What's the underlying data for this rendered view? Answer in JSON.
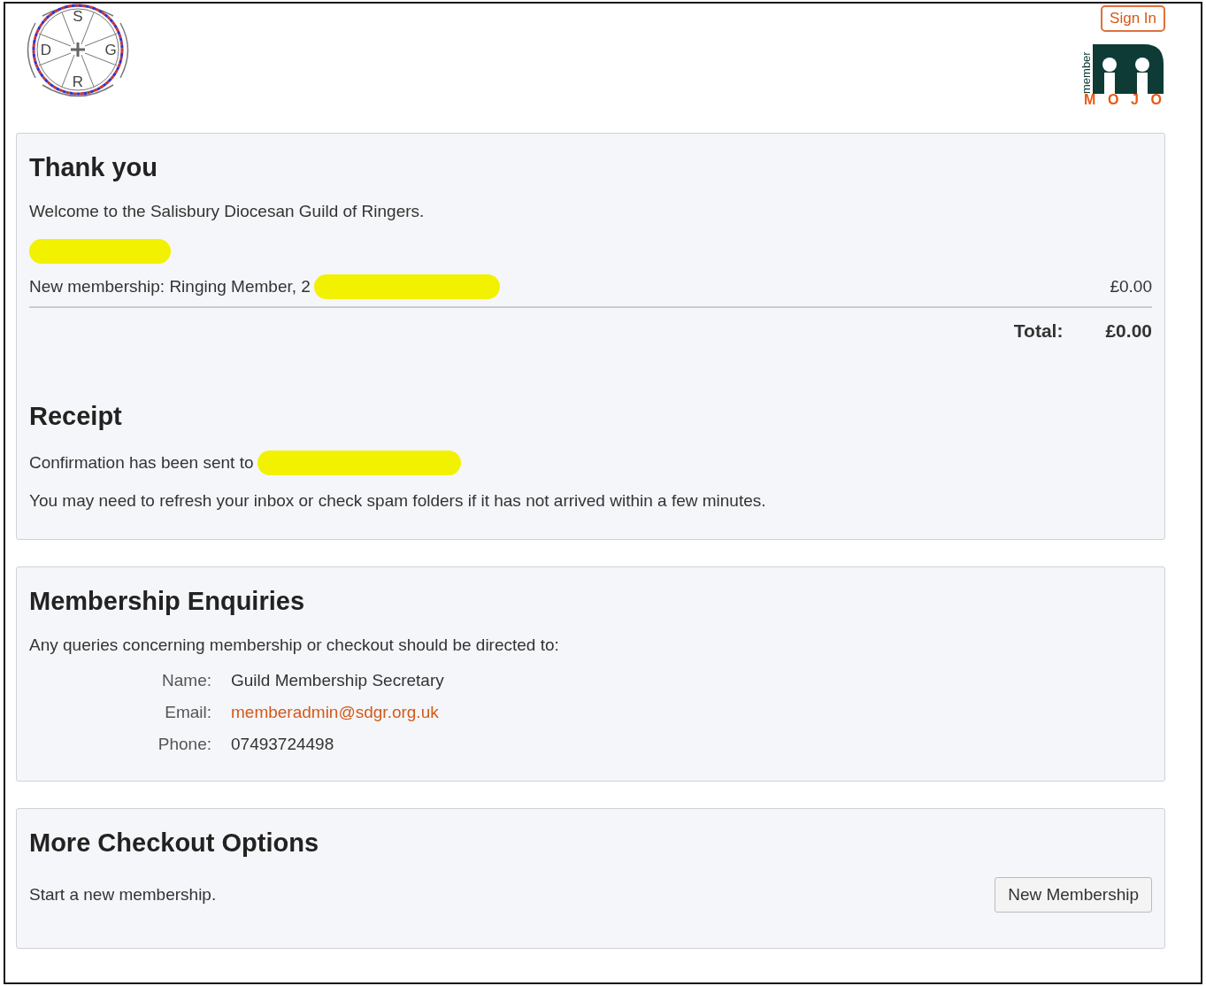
{
  "header": {
    "guild_logo_letters": [
      "S",
      "D",
      "G",
      "R"
    ],
    "sign_in": "Sign In",
    "brand_logo": {
      "top": "member",
      "bottom": "MOJO"
    }
  },
  "thank_you": {
    "title": "Thank you",
    "welcome": "Welcome to the Salisbury Diocesan Guild of Ringers.",
    "member_name_redacted": true,
    "lines": [
      {
        "description": "New membership: Ringing Member, 2",
        "redacted": true,
        "amount": "£0.00"
      }
    ],
    "total_label": "Total:",
    "total": "£0.00"
  },
  "receipt": {
    "title": "Receipt",
    "confirmation": "Confirmation has been sent to",
    "email_redacted": true,
    "note": "You may need to refresh your inbox or check spam folders if it has not arrived within a few minutes."
  },
  "enquiries": {
    "title": "Membership Enquiries",
    "intro": "Any queries concerning membership or checkout should be directed to:",
    "contacts": [
      {
        "label": "Name:",
        "value": "Guild Membership Secretary",
        "kind": "text"
      },
      {
        "label": "Email:",
        "value": "memberadmin@sdgr.org.uk",
        "kind": "link"
      },
      {
        "label": "Phone:",
        "value": "07493724498",
        "kind": "text"
      }
    ]
  },
  "checkout": {
    "title": "More Checkout Options",
    "text": "Start a new membership.",
    "button": "New Membership"
  }
}
